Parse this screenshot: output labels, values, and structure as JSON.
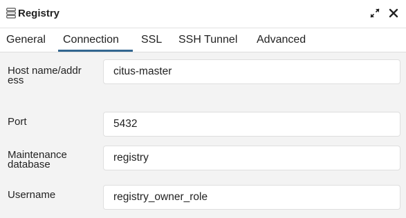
{
  "dialog": {
    "title": "Registry",
    "title_icon": "server-icon",
    "expand_icon": "expand-icon",
    "close_icon": "close-icon"
  },
  "tabs": [
    {
      "label": "General"
    },
    {
      "label": "Connection",
      "active": true
    },
    {
      "label": "SSL"
    },
    {
      "label": "SSH Tunnel"
    },
    {
      "label": "Advanced"
    }
  ],
  "form": {
    "host": {
      "label": "Host name/address",
      "value": "citus-master"
    },
    "port": {
      "label": "Port",
      "value": "5432"
    },
    "maintenance_db": {
      "label": "Maintenance database",
      "value": "registry"
    },
    "username": {
      "label": "Username",
      "value": "registry_owner_role"
    }
  },
  "colors": {
    "accent": "#326690",
    "panel_bg": "#f3f3f3",
    "input_border": "#dedede"
  }
}
